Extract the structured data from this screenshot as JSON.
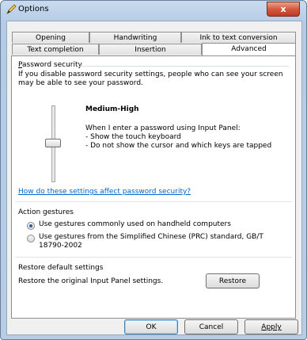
{
  "window": {
    "title": "Options",
    "close_glyph": "x"
  },
  "tabs": {
    "row1": [
      "Opening",
      "Handwriting",
      "Ink to text conversion"
    ],
    "row2": [
      "Text completion",
      "Insertion",
      "Advanced"
    ],
    "active": "Advanced"
  },
  "password_security": {
    "group_label": "Password security",
    "description": "If you disable password security settings, people who can see your screen may be able to see your password.",
    "level": "Medium-High",
    "level_desc_line1": "When I enter a password using Input Panel:",
    "level_desc_line2": "- Show the touch keyboard",
    "level_desc_line3": "- Do not show the cursor and which keys are tapped",
    "help_link": "How do these settings affect password security?"
  },
  "action_gestures": {
    "group_label": "Action gestures",
    "option1": "Use gestures commonly used on handheld computers",
    "option2_line1": "Use gestures from the Simplified Chinese (PRC) standard, GB/T",
    "option2_line2": "18790-2002",
    "selected": "option1"
  },
  "restore": {
    "group_label": "Restore default settings",
    "description": "Restore the original Input Panel settings.",
    "button": "Restore"
  },
  "footer": {
    "ok": "OK",
    "cancel": "Cancel",
    "apply": "Apply"
  }
}
